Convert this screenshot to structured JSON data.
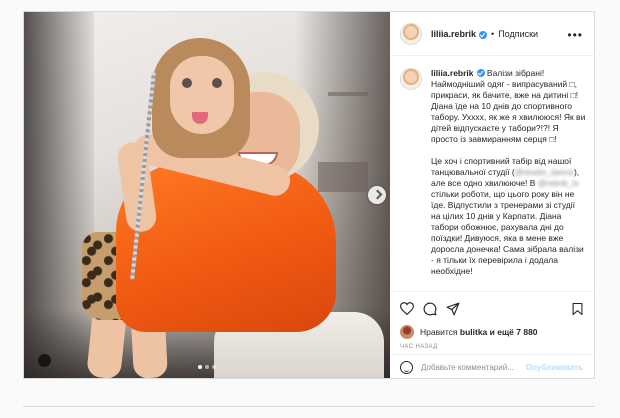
{
  "header": {
    "username": "liliia.rebrik",
    "separator": "•",
    "follow_label": "Подписки",
    "more_icon": "more-dots-icon"
  },
  "caption": {
    "username": "liliia.rebrik",
    "paragraphs": [
      "Валізи зібрані! Наймодніший одяг - випрасуваний \u0000, прикраси, як бачите, вже на дитині \u0000! Діана їде на 10 днів до спортивного табору. Ухххх, як же я хвилююся! Як ви дітей відпускаєте у табори?!?! Я просто із завмиранням серця \u0000!",
      "Це хоч і спортивний табір від нашої танцювальної студії",
      "але все одно хвилююче! В",
      "стільки роботи, що цього року він не їде. Відпустили з тренерами зі студії на цілих 10 днів у Карпати. Діана табори обожнює, рахувала дні до поїздки! Дивуюся, яка в мене вже доросла донечка! Сама зібрала валізи - я тільки їх",
      "перевірила і додала необхідне!"
    ],
    "blurred_1": "@studio_dance",
    "blurred_2": "@rebrik_tv",
    "blurred_3": "перевірила"
  },
  "actions": {
    "likes_prefix": "Нравится",
    "liked_by": "bulitka",
    "likes_suffix": "и ещё 7 880",
    "time": "ЧАС НАЗАД",
    "comment_placeholder": "Добавьте комментарий...",
    "post_label": "Опубликовать"
  },
  "carousel": {
    "dots": 3,
    "active_dot": 1
  }
}
